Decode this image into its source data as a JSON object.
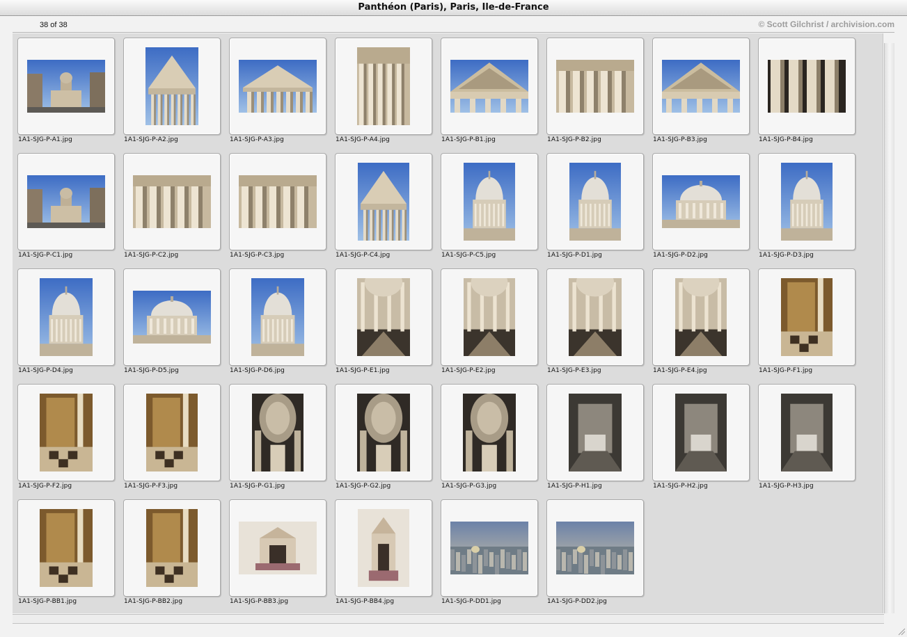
{
  "window": {
    "title": "Panthéon (Paris), Paris, Ile-de-France"
  },
  "header": {
    "count": "38 of 38",
    "copyright": "© Scott Gilchrist / archivision.com"
  },
  "thumbnails": [
    {
      "file": "1A1-SJG-P-A1.jpg"
    },
    {
      "file": "1A1-SJG-P-A2.jpg"
    },
    {
      "file": "1A1-SJG-P-A3.jpg"
    },
    {
      "file": "1A1-SJG-P-A4.jpg"
    },
    {
      "file": "1A1-SJG-P-B1.jpg"
    },
    {
      "file": "1A1-SJG-P-B2.jpg"
    },
    {
      "file": "1A1-SJG-P-B3.jpg"
    },
    {
      "file": "1A1-SJG-P-B4.jpg"
    },
    {
      "file": "1A1-SJG-P-C1.jpg"
    },
    {
      "file": "1A1-SJG-P-C2.jpg"
    },
    {
      "file": "1A1-SJG-P-C3.jpg"
    },
    {
      "file": "1A1-SJG-P-C4.jpg"
    },
    {
      "file": "1A1-SJG-P-C5.jpg"
    },
    {
      "file": "1A1-SJG-P-D1.jpg"
    },
    {
      "file": "1A1-SJG-P-D2.jpg"
    },
    {
      "file": "1A1-SJG-P-D3.jpg"
    },
    {
      "file": "1A1-SJG-P-D4.jpg"
    },
    {
      "file": "1A1-SJG-P-D5.jpg"
    },
    {
      "file": "1A1-SJG-P-D6.jpg"
    },
    {
      "file": "1A1-SJG-P-E1.jpg"
    },
    {
      "file": "1A1-SJG-P-E2.jpg"
    },
    {
      "file": "1A1-SJG-P-E3.jpg"
    },
    {
      "file": "1A1-SJG-P-E4.jpg"
    },
    {
      "file": "1A1-SJG-P-F1.jpg"
    },
    {
      "file": "1A1-SJG-P-F2.jpg"
    },
    {
      "file": "1A1-SJG-P-F3.jpg"
    },
    {
      "file": "1A1-SJG-P-G1.jpg"
    },
    {
      "file": "1A1-SJG-P-G2.jpg"
    },
    {
      "file": "1A1-SJG-P-G3.jpg"
    },
    {
      "file": "1A1-SJG-P-H1.jpg"
    },
    {
      "file": "1A1-SJG-P-H2.jpg"
    },
    {
      "file": "1A1-SJG-P-H3.jpg"
    },
    {
      "file": "1A1-SJG-P-BB1.jpg"
    },
    {
      "file": "1A1-SJG-P-BB2.jpg"
    },
    {
      "file": "1A1-SJG-P-BB3.jpg"
    },
    {
      "file": "1A1-SJG-P-BB4.jpg"
    },
    {
      "file": "1A1-SJG-P-DD1.jpg"
    },
    {
      "file": "1A1-SJG-P-DD2.jpg"
    }
  ]
}
